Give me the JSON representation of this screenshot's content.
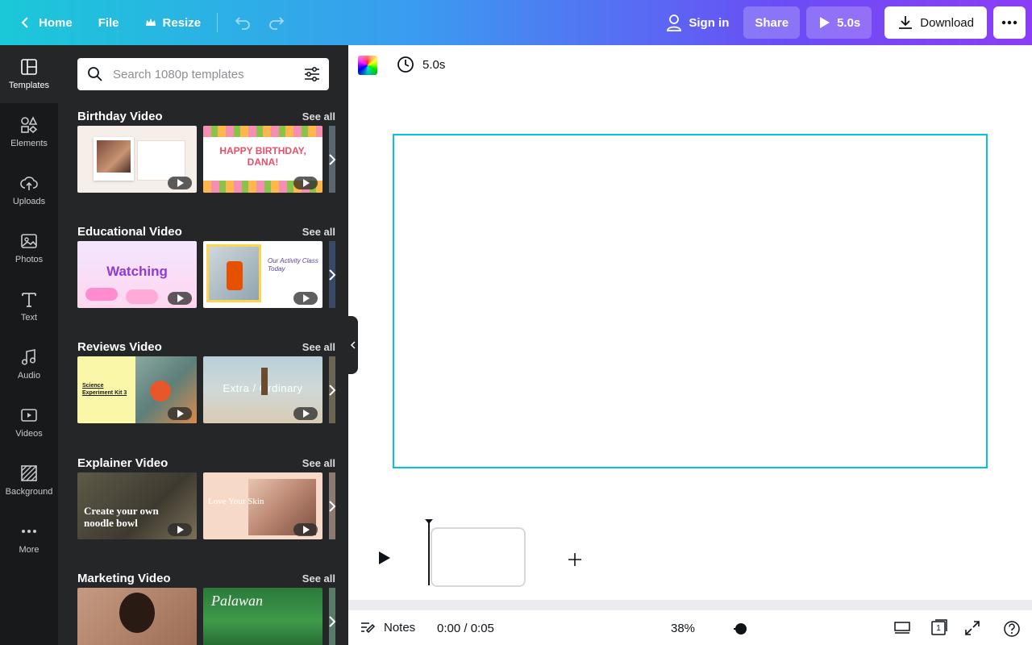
{
  "topbar": {
    "home_label": "Home",
    "file_label": "File",
    "resize_label": "Resize",
    "signin_label": "Sign in",
    "share_label": "Share",
    "play_label": "5.0s",
    "download_label": "Download"
  },
  "rail": {
    "items": [
      {
        "label": "Templates"
      },
      {
        "label": "Elements"
      },
      {
        "label": "Uploads"
      },
      {
        "label": "Photos"
      },
      {
        "label": "Text"
      },
      {
        "label": "Audio"
      },
      {
        "label": "Videos"
      },
      {
        "label": "Background"
      },
      {
        "label": "More"
      }
    ]
  },
  "panel": {
    "search_placeholder": "Search 1080p templates",
    "see_all_label": "See all",
    "sections": [
      {
        "title": "Birthday Video",
        "thumb1_text": "",
        "thumb2_text": "HAPPY BIRTHDAY, DANA!"
      },
      {
        "title": "Educational Video",
        "thumb1_text": "Watching",
        "thumb2_text": "Our Activity Class Today"
      },
      {
        "title": "Reviews Video",
        "thumb1_text": "Science Experiment Kit 3",
        "thumb2_text": "Extra / Ordinary"
      },
      {
        "title": "Explainer Video",
        "thumb1_text": "Create your own noodle bowl",
        "thumb2_text": "Love Your Skin"
      },
      {
        "title": "Marketing Video",
        "thumb1_text": "",
        "thumb2_text": "Palawan"
      }
    ]
  },
  "editor": {
    "duration_label": "5.0s",
    "notes_label": "Notes",
    "time_label": "0:00 / 0:05",
    "zoom_label": "38%",
    "page_count": "1"
  },
  "colors": {
    "accent": "#00c4e0",
    "panel_bg": "#252627",
    "rail_bg": "#18191b"
  }
}
